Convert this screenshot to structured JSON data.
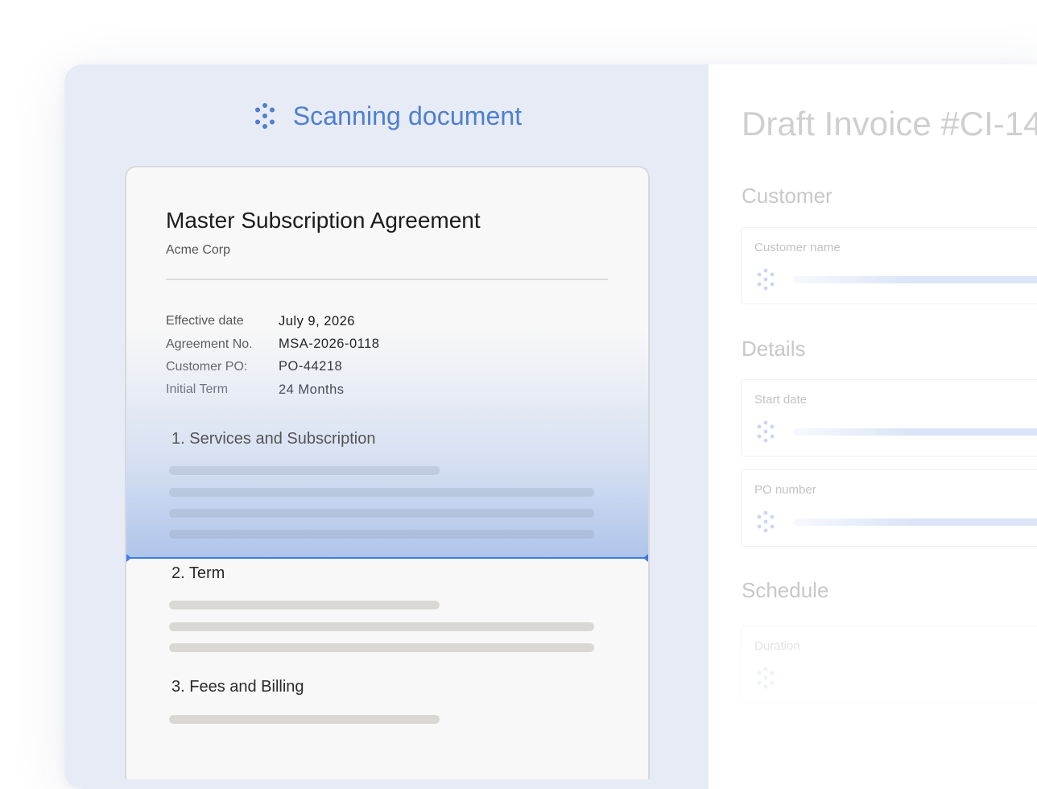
{
  "scan_header": {
    "title": "Scanning document",
    "icon": "spinner-dots-icon"
  },
  "document": {
    "title": "Master Subscription Agreement",
    "subtitle": "Acme Corp",
    "meta": [
      {
        "label": "Effective date",
        "value": "July 9, 2026"
      },
      {
        "label": "Agreement No.",
        "value": "MSA-2026-0118"
      },
      {
        "label": "Customer PO:",
        "value": "PO-44218"
      },
      {
        "label": "Initial Term",
        "value": "24 Months"
      }
    ],
    "sections": [
      {
        "title": "1. Services and Subscription"
      },
      {
        "title": "2. Term"
      },
      {
        "title": "3. Fees and Billing"
      }
    ]
  },
  "invoice": {
    "title": "Draft Invoice #CI-14",
    "sections": {
      "customer": "Customer",
      "details": "Details",
      "schedule": "Schedule"
    },
    "fields": {
      "customer_name": "Customer name",
      "start_date": "Start date",
      "po_number": "PO number",
      "duration": "Duration"
    }
  },
  "colors": {
    "accent": "#4e7fd0",
    "scan_line": "#3d7bea",
    "panel_bg": "#e6ebf5"
  }
}
